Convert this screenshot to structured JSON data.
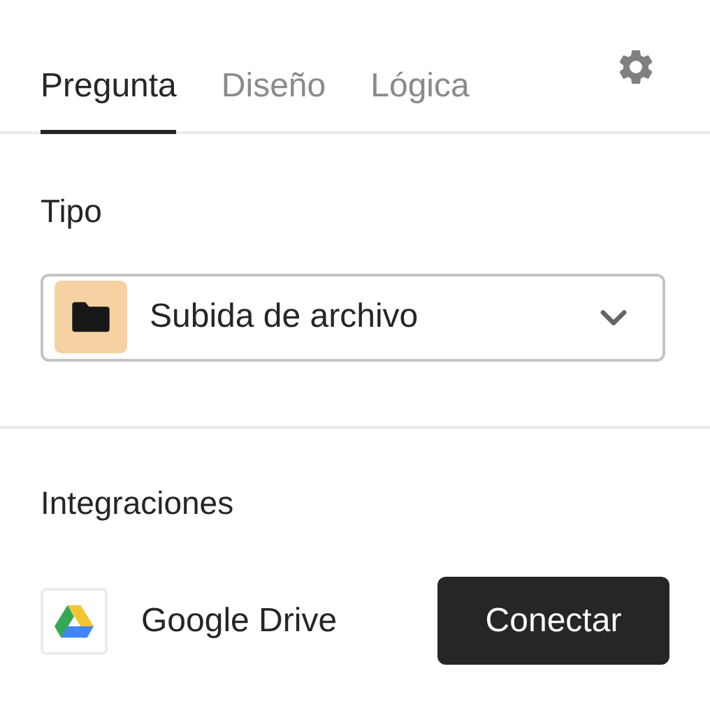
{
  "tabs": [
    {
      "label": "Pregunta",
      "selected": true
    },
    {
      "label": "Diseño",
      "selected": false
    },
    {
      "label": "Lógica",
      "selected": false
    }
  ],
  "type_section": {
    "title": "Tipo",
    "select": {
      "value": "Subida de archivo"
    }
  },
  "integrations": {
    "title": "Integraciones",
    "items": [
      {
        "name": "Google Drive",
        "action": "Conectar"
      }
    ]
  }
}
